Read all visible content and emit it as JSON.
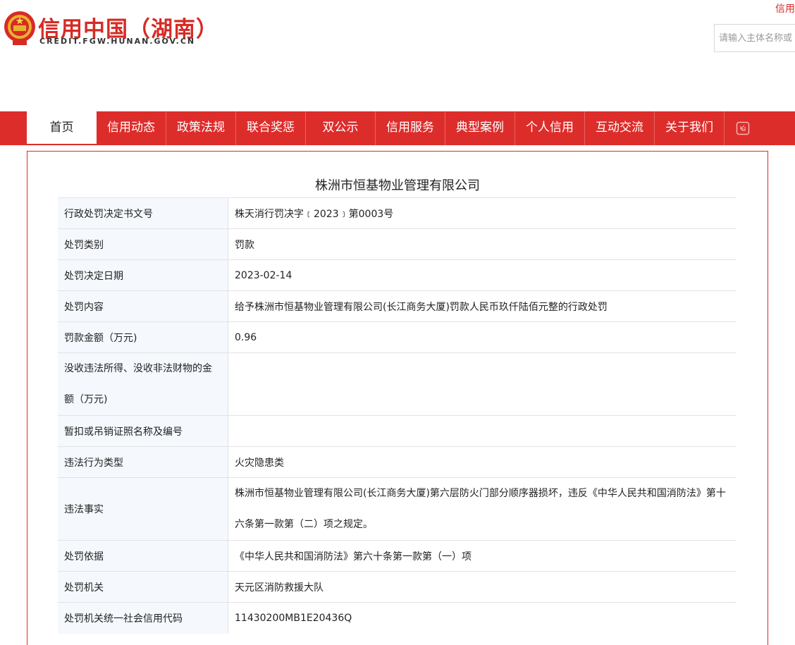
{
  "header": {
    "title": "信用中国（湖南）",
    "domain": "CREDIT.FGW.HUNAN.GOV.CN",
    "top_link": "信用",
    "search_placeholder": "请输入主体名称或"
  },
  "nav": {
    "items": [
      {
        "label": "首页",
        "active": true
      },
      {
        "label": "信用动态"
      },
      {
        "label": "政策法规"
      },
      {
        "label": "联合奖惩"
      },
      {
        "label": "双公示"
      },
      {
        "label": "信用服务"
      },
      {
        "label": "典型案例"
      },
      {
        "label": "个人信用"
      },
      {
        "label": "互动交流"
      },
      {
        "label": "关于我们"
      }
    ],
    "expand_icon": "expand-icon"
  },
  "record": {
    "company": "株洲市恒基物业管理有限公司",
    "rows": [
      {
        "label": "行政处罚决定书文号",
        "value": "株天消行罚决字﹝2023﹞第0003号"
      },
      {
        "label": "处罚类别",
        "value": "罚款"
      },
      {
        "label": "处罚决定日期",
        "value": "2023-02-14"
      },
      {
        "label": "处罚内容",
        "value": "给予株洲市恒基物业管理有限公司(长江商务大厦)罚款人民币玖仟陆佰元整的行政处罚"
      },
      {
        "label": "罚款金额（万元)",
        "value": "0.96"
      },
      {
        "label": "没收违法所得、没收非法财物的金额（万元)",
        "value": ""
      },
      {
        "label": "暂扣或吊销证照名称及编号",
        "value": ""
      },
      {
        "label": "违法行为类型",
        "value": "火灾隐患类"
      },
      {
        "label": "违法事实",
        "value": "株洲市恒基物业管理有限公司(长江商务大厦)第六层防火门部分顺序器损坏，违反《中华人民共和国消防法》第十六条第一款第（二）项之规定。"
      },
      {
        "label": "处罚依据",
        "value": "《中华人民共和国消防法》第六十条第一款第（一）项"
      },
      {
        "label": "处罚机关",
        "value": "天元区消防救援大队"
      },
      {
        "label": "处罚机关统一社会信用代码",
        "value": "11430200MB1E20436Q"
      }
    ]
  },
  "colors": {
    "brand_red": "#dd2d2b",
    "label_bg": "#f5f8fd"
  }
}
